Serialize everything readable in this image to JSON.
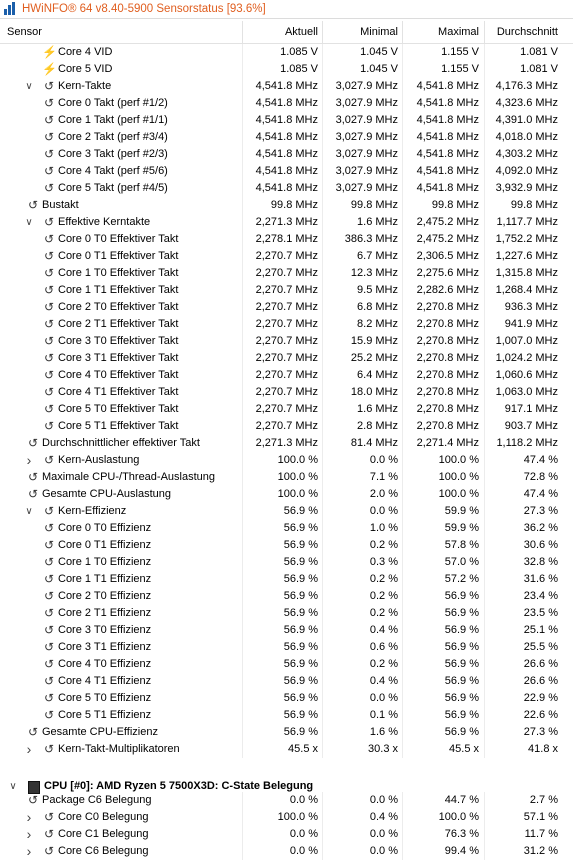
{
  "window": {
    "title": "HWiNFO® 64 v8.40-5900 Sensorstatus [93.6%]"
  },
  "header": {
    "sensor": "Sensor",
    "current": "Aktuell",
    "min": "Minimal",
    "max": "Maximal",
    "avg": "Durchschnitt"
  },
  "rows": [
    {
      "indent": 2,
      "chev": "",
      "icon": "bolt",
      "name": "Core 4 VID",
      "v": [
        "1.085 V",
        "1.045 V",
        "1.155 V",
        "1.081 V"
      ]
    },
    {
      "indent": 2,
      "chev": "",
      "icon": "bolt",
      "name": "Core 5 VID",
      "v": [
        "1.085 V",
        "1.045 V",
        "1.155 V",
        "1.081 V"
      ]
    },
    {
      "indent": 1,
      "chev": "expanded",
      "icon": "clock",
      "name": "Kern-Takte",
      "v": [
        "4,541.8 MHz",
        "3,027.9 MHz",
        "4,541.8 MHz",
        "4,176.3 MHz"
      ]
    },
    {
      "indent": 2,
      "chev": "",
      "icon": "clock",
      "name": "Core 0 Takt (perf #1/2)",
      "v": [
        "4,541.8 MHz",
        "3,027.9 MHz",
        "4,541.8 MHz",
        "4,323.6 MHz"
      ]
    },
    {
      "indent": 2,
      "chev": "",
      "icon": "clock",
      "name": "Core 1 Takt (perf #1/1)",
      "v": [
        "4,541.8 MHz",
        "3,027.9 MHz",
        "4,541.8 MHz",
        "4,391.0 MHz"
      ]
    },
    {
      "indent": 2,
      "chev": "",
      "icon": "clock",
      "name": "Core 2 Takt (perf #3/4)",
      "v": [
        "4,541.8 MHz",
        "3,027.9 MHz",
        "4,541.8 MHz",
        "4,018.0 MHz"
      ]
    },
    {
      "indent": 2,
      "chev": "",
      "icon": "clock",
      "name": "Core 3 Takt (perf #2/3)",
      "v": [
        "4,541.8 MHz",
        "3,027.9 MHz",
        "4,541.8 MHz",
        "4,303.2 MHz"
      ]
    },
    {
      "indent": 2,
      "chev": "",
      "icon": "clock",
      "name": "Core 4 Takt (perf #5/6)",
      "v": [
        "4,541.8 MHz",
        "3,027.9 MHz",
        "4,541.8 MHz",
        "4,092.0 MHz"
      ]
    },
    {
      "indent": 2,
      "chev": "",
      "icon": "clock",
      "name": "Core 5 Takt (perf #4/5)",
      "v": [
        "4,541.8 MHz",
        "3,027.9 MHz",
        "4,541.8 MHz",
        "3,932.9 MHz"
      ]
    },
    {
      "indent": 0,
      "chev": "",
      "icon": "clock",
      "name": "Bustakt",
      "v": [
        "99.8 MHz",
        "99.8 MHz",
        "99.8 MHz",
        "99.8 MHz"
      ]
    },
    {
      "indent": 1,
      "chev": "expanded",
      "icon": "clock",
      "name": "Effektive Kerntakte",
      "v": [
        "2,271.3 MHz",
        "1.6 MHz",
        "2,475.2 MHz",
        "1,117.7 MHz"
      ]
    },
    {
      "indent": 2,
      "chev": "",
      "icon": "clock",
      "name": "Core 0 T0 Effektiver Takt",
      "v": [
        "2,278.1 MHz",
        "386.3 MHz",
        "2,475.2 MHz",
        "1,752.2 MHz"
      ]
    },
    {
      "indent": 2,
      "chev": "",
      "icon": "clock",
      "name": "Core 0 T1 Effektiver Takt",
      "v": [
        "2,270.7 MHz",
        "6.7 MHz",
        "2,306.5 MHz",
        "1,227.6 MHz"
      ]
    },
    {
      "indent": 2,
      "chev": "",
      "icon": "clock",
      "name": "Core 1 T0 Effektiver Takt",
      "v": [
        "2,270.7 MHz",
        "12.3 MHz",
        "2,275.6 MHz",
        "1,315.8 MHz"
      ]
    },
    {
      "indent": 2,
      "chev": "",
      "icon": "clock",
      "name": "Core 1 T1 Effektiver Takt",
      "v": [
        "2,270.7 MHz",
        "9.5 MHz",
        "2,282.6 MHz",
        "1,268.4 MHz"
      ]
    },
    {
      "indent": 2,
      "chev": "",
      "icon": "clock",
      "name": "Core 2 T0 Effektiver Takt",
      "v": [
        "2,270.7 MHz",
        "6.8 MHz",
        "2,270.8 MHz",
        "936.3 MHz"
      ]
    },
    {
      "indent": 2,
      "chev": "",
      "icon": "clock",
      "name": "Core 2 T1 Effektiver Takt",
      "v": [
        "2,270.7 MHz",
        "8.2 MHz",
        "2,270.8 MHz",
        "941.9 MHz"
      ]
    },
    {
      "indent": 2,
      "chev": "",
      "icon": "clock",
      "name": "Core 3 T0 Effektiver Takt",
      "v": [
        "2,270.7 MHz",
        "15.9 MHz",
        "2,270.8 MHz",
        "1,007.0 MHz"
      ]
    },
    {
      "indent": 2,
      "chev": "",
      "icon": "clock",
      "name": "Core 3 T1 Effektiver Takt",
      "v": [
        "2,270.7 MHz",
        "25.2 MHz",
        "2,270.8 MHz",
        "1,024.2 MHz"
      ]
    },
    {
      "indent": 2,
      "chev": "",
      "icon": "clock",
      "name": "Core 4 T0 Effektiver Takt",
      "v": [
        "2,270.7 MHz",
        "6.4 MHz",
        "2,270.8 MHz",
        "1,060.6 MHz"
      ]
    },
    {
      "indent": 2,
      "chev": "",
      "icon": "clock",
      "name": "Core 4 T1 Effektiver Takt",
      "v": [
        "2,270.7 MHz",
        "18.0 MHz",
        "2,270.8 MHz",
        "1,063.0 MHz"
      ]
    },
    {
      "indent": 2,
      "chev": "",
      "icon": "clock",
      "name": "Core 5 T0 Effektiver Takt",
      "v": [
        "2,270.7 MHz",
        "1.6 MHz",
        "2,270.8 MHz",
        "917.1 MHz"
      ]
    },
    {
      "indent": 2,
      "chev": "",
      "icon": "clock",
      "name": "Core 5 T1 Effektiver Takt",
      "v": [
        "2,270.7 MHz",
        "2.8 MHz",
        "2,270.8 MHz",
        "903.7 MHz"
      ]
    },
    {
      "indent": 0,
      "chev": "",
      "icon": "clock",
      "name": "Durchschnittlicher effektiver Takt",
      "v": [
        "2,271.3 MHz",
        "81.4 MHz",
        "2,271.4 MHz",
        "1,118.2 MHz"
      ]
    },
    {
      "indent": 1,
      "chev": "collapsed",
      "icon": "usage",
      "name": "Kern-Auslastung",
      "v": [
        "100.0 %",
        "0.0 %",
        "100.0 %",
        "47.4 %"
      ]
    },
    {
      "indent": 0,
      "chev": "",
      "icon": "usage",
      "name": "Maximale CPU-/Thread-Auslastung",
      "v": [
        "100.0 %",
        "7.1 %",
        "100.0 %",
        "72.8 %"
      ]
    },
    {
      "indent": 0,
      "chev": "",
      "icon": "usage",
      "name": "Gesamte CPU-Auslastung",
      "v": [
        "100.0 %",
        "2.0 %",
        "100.0 %",
        "47.4 %"
      ]
    },
    {
      "indent": 1,
      "chev": "expanded",
      "icon": "usage",
      "name": "Kern-Effizienz",
      "v": [
        "56.9 %",
        "0.0 %",
        "59.9 %",
        "27.3 %"
      ]
    },
    {
      "indent": 2,
      "chev": "",
      "icon": "usage",
      "name": "Core 0 T0 Effizienz",
      "v": [
        "56.9 %",
        "1.0 %",
        "59.9 %",
        "36.2 %"
      ]
    },
    {
      "indent": 2,
      "chev": "",
      "icon": "usage",
      "name": "Core 0 T1 Effizienz",
      "v": [
        "56.9 %",
        "0.2 %",
        "57.8 %",
        "30.6 %"
      ]
    },
    {
      "indent": 2,
      "chev": "",
      "icon": "usage",
      "name": "Core 1 T0 Effizienz",
      "v": [
        "56.9 %",
        "0.3 %",
        "57.0 %",
        "32.8 %"
      ]
    },
    {
      "indent": 2,
      "chev": "",
      "icon": "usage",
      "name": "Core 1 T1 Effizienz",
      "v": [
        "56.9 %",
        "0.2 %",
        "57.2 %",
        "31.6 %"
      ]
    },
    {
      "indent": 2,
      "chev": "",
      "icon": "usage",
      "name": "Core 2 T0 Effizienz",
      "v": [
        "56.9 %",
        "0.2 %",
        "56.9 %",
        "23.4 %"
      ]
    },
    {
      "indent": 2,
      "chev": "",
      "icon": "usage",
      "name": "Core 2 T1 Effizienz",
      "v": [
        "56.9 %",
        "0.2 %",
        "56.9 %",
        "23.5 %"
      ]
    },
    {
      "indent": 2,
      "chev": "",
      "icon": "usage",
      "name": "Core 3 T0 Effizienz",
      "v": [
        "56.9 %",
        "0.4 %",
        "56.9 %",
        "25.1 %"
      ]
    },
    {
      "indent": 2,
      "chev": "",
      "icon": "usage",
      "name": "Core 3 T1 Effizienz",
      "v": [
        "56.9 %",
        "0.6 %",
        "56.9 %",
        "25.5 %"
      ]
    },
    {
      "indent": 2,
      "chev": "",
      "icon": "usage",
      "name": "Core 4 T0 Effizienz",
      "v": [
        "56.9 %",
        "0.2 %",
        "56.9 %",
        "26.6 %"
      ]
    },
    {
      "indent": 2,
      "chev": "",
      "icon": "usage",
      "name": "Core 4 T1 Effizienz",
      "v": [
        "56.9 %",
        "0.4 %",
        "56.9 %",
        "26.6 %"
      ]
    },
    {
      "indent": 2,
      "chev": "",
      "icon": "usage",
      "name": "Core 5 T0 Effizienz",
      "v": [
        "56.9 %",
        "0.0 %",
        "56.9 %",
        "22.9 %"
      ]
    },
    {
      "indent": 2,
      "chev": "",
      "icon": "usage",
      "name": "Core 5 T1 Effizienz",
      "v": [
        "56.9 %",
        "0.1 %",
        "56.9 %",
        "22.6 %"
      ]
    },
    {
      "indent": 0,
      "chev": "",
      "icon": "usage",
      "name": "Gesamte CPU-Effizienz",
      "v": [
        "56.9 %",
        "1.6 %",
        "56.9 %",
        "27.3 %"
      ]
    },
    {
      "indent": 1,
      "chev": "collapsed",
      "icon": "clock",
      "name": "Kern-Takt-Multiplikatoren",
      "v": [
        "45.5 x",
        "30.3 x",
        "45.5 x",
        "41.8 x"
      ]
    },
    {
      "indent": 0,
      "chev": "",
      "icon": "",
      "name": "",
      "v": [
        "",
        "",
        "",
        ""
      ]
    },
    {
      "indent": -1,
      "chev": "expanded",
      "icon": "chip",
      "name": "CPU [#0]: AMD Ryzen 5 7500X3D: C-State Belegung",
      "v": [
        "",
        "",
        "",
        ""
      ],
      "section": true
    },
    {
      "indent": 0,
      "chev": "",
      "icon": "clock",
      "name": "Package C6 Belegung",
      "v": [
        "0.0 %",
        "0.0 %",
        "44.7 %",
        "2.7 %"
      ]
    },
    {
      "indent": 1,
      "chev": "collapsed",
      "icon": "clock",
      "name": "Core C0 Belegung",
      "v": [
        "100.0 %",
        "0.4 %",
        "100.0 %",
        "57.1 %"
      ]
    },
    {
      "indent": 1,
      "chev": "collapsed",
      "icon": "clock",
      "name": "Core C1 Belegung",
      "v": [
        "0.0 %",
        "0.0 %",
        "76.3 %",
        "11.7 %"
      ]
    },
    {
      "indent": 1,
      "chev": "collapsed",
      "icon": "clock",
      "name": "Core C6 Belegung",
      "v": [
        "0.0 %",
        "0.0 %",
        "99.4 %",
        "31.2 %"
      ]
    }
  ]
}
